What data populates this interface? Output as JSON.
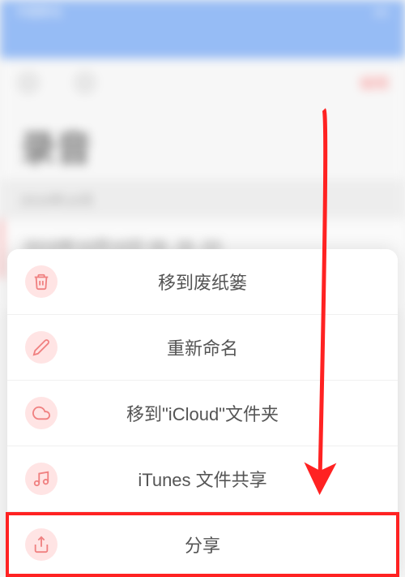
{
  "statusbar": {
    "carrier": "中国移动",
    "network": "4G",
    "time": "",
    "right": ""
  },
  "toolbar": {
    "edit_label": "编辑"
  },
  "page": {
    "title": "录音"
  },
  "section": {
    "header": "2019年10月"
  },
  "recording": {
    "name": "2019年10月10日 08_26_03",
    "meta_left": "",
    "meta_right": ""
  },
  "actions": [
    {
      "icon": "trash",
      "label": "移到废纸篓"
    },
    {
      "icon": "pencil",
      "label": "重新命名"
    },
    {
      "icon": "cloud",
      "label": "移到\"iCloud\"文件夹"
    },
    {
      "icon": "music",
      "label": "iTunes 文件共享"
    },
    {
      "icon": "share",
      "label": "分享"
    }
  ],
  "colors": {
    "accent": "#ff5555",
    "iconbg": "#ffe4e4",
    "iconfg": "#f08080"
  }
}
